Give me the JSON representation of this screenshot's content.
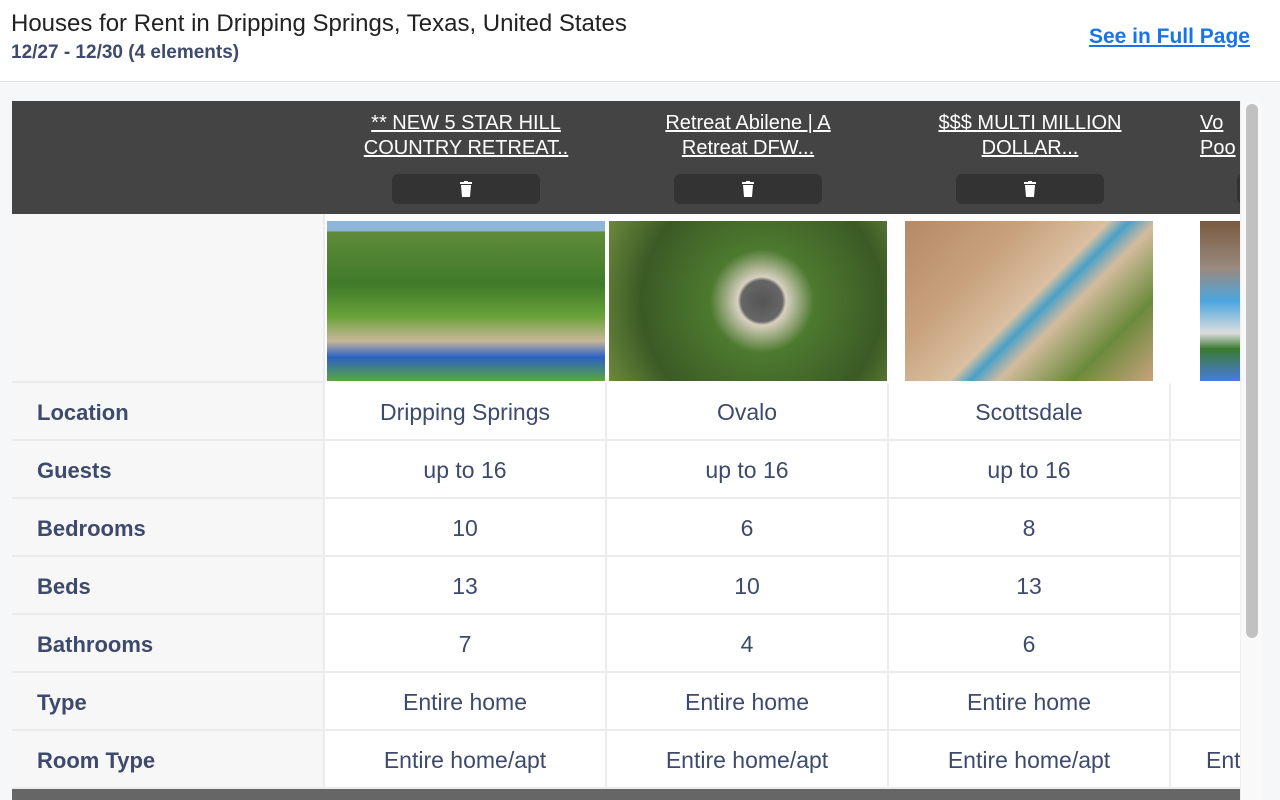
{
  "header": {
    "title": "Houses for Rent in Dripping Springs, Texas, United States",
    "subtitle": "12/27 - 12/30 (4 elements)",
    "full_page_link": "See in Full Page"
  },
  "listings": [
    {
      "title": "** NEW 5 STAR HILL\nCOUNTRY RETREAT..",
      "delete_icon": "trash-icon"
    },
    {
      "title": "Retreat Abilene | A\nRetreat DFW...",
      "delete_icon": "trash-icon"
    },
    {
      "title": "$$$ MULTI MILLION\nDOLLAR...",
      "delete_icon": "trash-icon"
    },
    {
      "title": "Vo\nPoo",
      "delete_icon": "trash-icon"
    }
  ],
  "rows": [
    {
      "label": "Location",
      "values": [
        "Dripping Springs",
        "Ovalo",
        "Scottsdale",
        ""
      ]
    },
    {
      "label": "Guests",
      "values": [
        "up to 16",
        "up to 16",
        "up to 16",
        ""
      ]
    },
    {
      "label": "Bedrooms",
      "values": [
        "10",
        "6",
        "8",
        ""
      ]
    },
    {
      "label": "Beds",
      "values": [
        "13",
        "10",
        "13",
        ""
      ]
    },
    {
      "label": "Bathrooms",
      "values": [
        "7",
        "4",
        "6",
        ""
      ]
    },
    {
      "label": "Type",
      "values": [
        "Entire home",
        "Entire home",
        "Entire home",
        ""
      ]
    },
    {
      "label": "Room Type",
      "values": [
        "Entire home/apt",
        "Entire home/apt",
        "Entire home/apt",
        "Entire home/apt"
      ]
    }
  ],
  "colors": {
    "header_bg": "#444444",
    "link": "#1a73e8",
    "text": "#3d4a6b"
  }
}
